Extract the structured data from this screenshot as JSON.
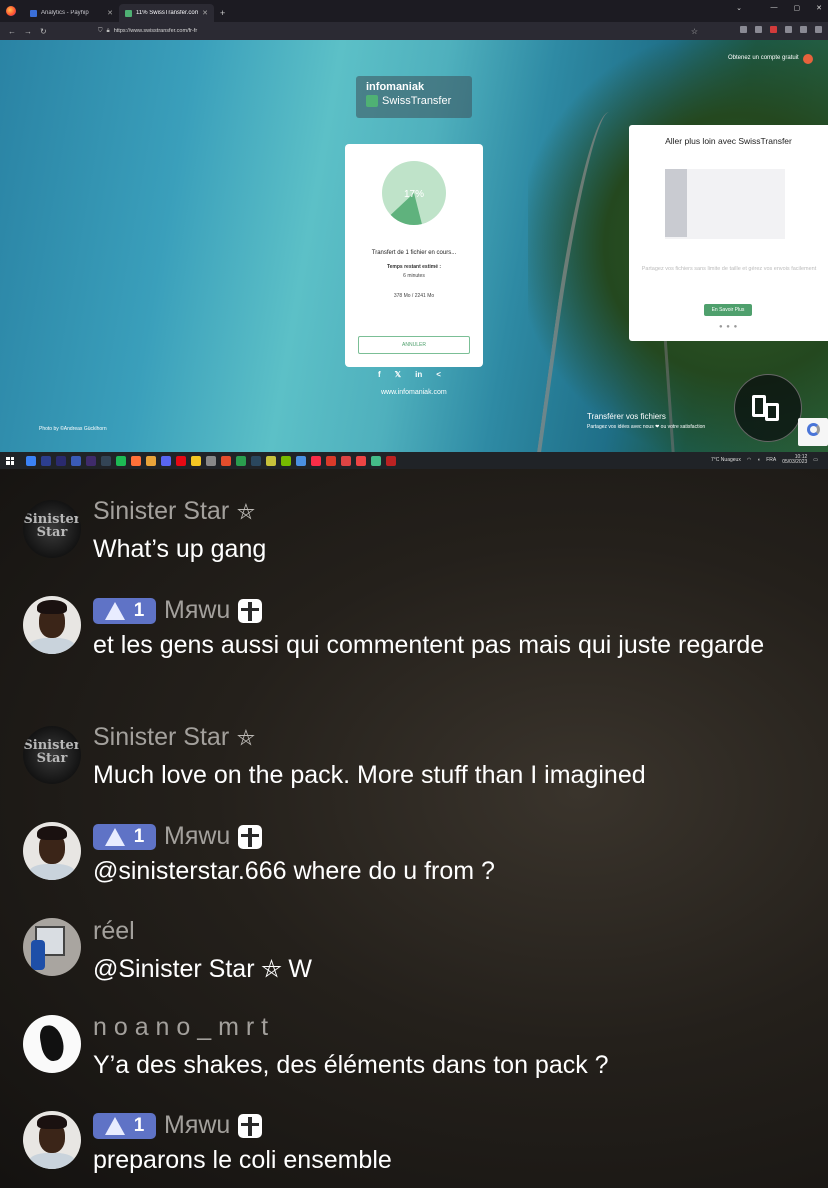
{
  "browser": {
    "tabs": [
      {
        "title": "Analytics - Payhip",
        "active": false
      },
      {
        "title": "11% SwissTransfer.com - Envoi",
        "active": true
      }
    ],
    "url": "https://www.swisstransfer.com/fr-fr"
  },
  "page": {
    "brand_name": "infomaniak",
    "product_name": "SwissTransfer",
    "signin": "Obtenez un compte gratuit",
    "upload": {
      "percent_label": "17%",
      "progress": 0.17,
      "status": "Transfert de 1 fichier en cours...",
      "remaining_label": "Temps restant estimé :",
      "remaining_value": "6 minutes",
      "size": "378 Mo / 2241 Mo",
      "cancel_label": "ANNULER"
    },
    "social_icons": [
      "facebook-icon",
      "twitter-icon",
      "linkedin-icon",
      "share-icon"
    ],
    "social_glyphs": [
      "f",
      "𝕏",
      "in",
      "<"
    ],
    "website": "www.infomaniak.com",
    "photo_credit": "Photo by ©Andreas Gücklhorn",
    "promo": {
      "title": "Aller plus loin avec SwissTransfer",
      "description": "Partagez vos fichiers sans limite de taille et gérez vos envois facilement",
      "button": "En Savoir Plus"
    },
    "footer": {
      "title": "Transférer vos fichiers",
      "subtitle": "Partagez vos idées avec nous ❤ ou votre satisfaction"
    }
  },
  "taskbar": {
    "weather": "7°C Nuageux",
    "lang": "FRA",
    "time": "10:12",
    "date": "05/03/2023",
    "app_colors": [
      "#3b82f6",
      "#2c3e8f",
      "#2a2a6e",
      "#3a5bb8",
      "#3f2b6b",
      "#345",
      "#1db954",
      "#ff7139",
      "#e8a33a",
      "#5865f2",
      "#e50914",
      "#f3c623",
      "#888",
      "#e34d2c",
      "#2a9d4e",
      "#2a475e",
      "#c7c13b",
      "#76b900",
      "#4a90e2",
      "#fa2d48",
      "#d93a2a",
      "#d44",
      "#e44",
      "#4b8",
      "#b22"
    ]
  },
  "chat": {
    "messages": [
      {
        "user": "Sinister Star",
        "pentagram": "⛤",
        "text": "What’s up gang",
        "avatar": "sinister-star-avatar",
        "avatar_text": "Sinister Star"
      },
      {
        "user": "Мяwu",
        "badge_level": "1",
        "text": "et les gens aussi qui commentent pas mais qui juste regarde",
        "avatar": "mywu-avatar"
      },
      {
        "user": "Sinister Star",
        "pentagram": "⛤",
        "text": "Much love on the pack. More stuff than I imagined",
        "avatar": "sinister-star-avatar",
        "avatar_text": "Sinister Star"
      },
      {
        "user": "Мяwu",
        "badge_level": "1",
        "text": "@sinisterstar.666 where do u from ?",
        "avatar": "mywu-avatar"
      },
      {
        "user": "réel",
        "text": "@Sinister Star ⛤ W",
        "avatar": "reel-avatar"
      },
      {
        "user": "n o a n o _ m r t",
        "text": "Y’a des shakes, des éléments dans ton pack ?",
        "avatar": "noano-avatar"
      },
      {
        "user": "Мяwu",
        "badge_level": "1",
        "text": "preparons le coli ensemble",
        "avatar": "mywu-avatar"
      }
    ]
  }
}
